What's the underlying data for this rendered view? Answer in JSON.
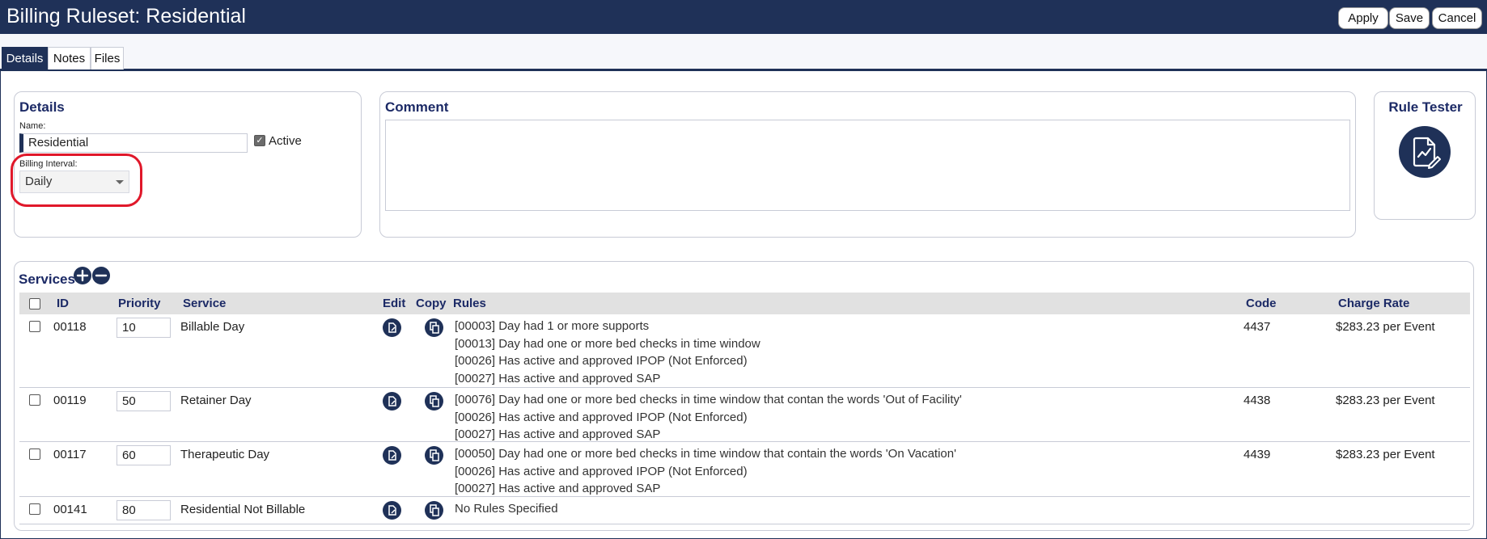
{
  "header": {
    "title": "Billing Ruleset: Residential",
    "buttons": {
      "apply": "Apply",
      "save": "Save",
      "cancel": "Cancel"
    }
  },
  "tabs": [
    {
      "label": "Details",
      "active": true
    },
    {
      "label": "Notes",
      "active": false
    },
    {
      "label": "Files",
      "active": false
    }
  ],
  "details": {
    "title": "Details",
    "name_label": "Name:",
    "name_value": "Residential",
    "active_label": "Active",
    "active_checked": true,
    "interval_label": "Billing Interval:",
    "interval_value": "Daily"
  },
  "comment": {
    "title": "Comment",
    "value": ""
  },
  "rule_tester": {
    "title": "Rule Tester",
    "icon": "document-chart-icon"
  },
  "services": {
    "title": "Services",
    "columns": {
      "id": "ID",
      "priority": "Priority",
      "service": "Service",
      "edit": "Edit",
      "copy": "Copy",
      "rules": "Rules",
      "code": "Code",
      "charge_rate": "Charge Rate"
    },
    "rows": [
      {
        "id": "00118",
        "priority": "10",
        "service": "Billable Day",
        "rules": [
          "[00003] Day had 1 or more supports",
          "[00013] Day had one or more bed checks in time window",
          "[00026] Has active and approved IPOP (Not Enforced)",
          "[00027] Has active and approved SAP"
        ],
        "code": "4437",
        "charge_rate": "$283.23 per Event"
      },
      {
        "id": "00119",
        "priority": "50",
        "service": "Retainer Day",
        "rules": [
          "[00076] Day had one or more bed checks in time window that contan the words 'Out of Facility'",
          "[00026] Has active and approved IPOP (Not Enforced)",
          "[00027] Has active and approved SAP"
        ],
        "code": "4438",
        "charge_rate": "$283.23 per Event"
      },
      {
        "id": "00117",
        "priority": "60",
        "service": "Therapeutic Day",
        "rules": [
          "[00050] Day had one or more bed checks in time window that contain the words 'On Vacation'",
          "[00026] Has active and approved IPOP (Not Enforced)",
          "[00027] Has active and approved SAP"
        ],
        "code": "4439",
        "charge_rate": "$283.23 per Event"
      },
      {
        "id": "00141",
        "priority": "80",
        "service": "Residential Not Billable",
        "rules": [
          "No Rules Specified"
        ],
        "code": "",
        "charge_rate": ""
      }
    ]
  },
  "colors": {
    "navy": "#1f3158",
    "heading": "#1c2a66",
    "highlight": "#e0182a"
  }
}
